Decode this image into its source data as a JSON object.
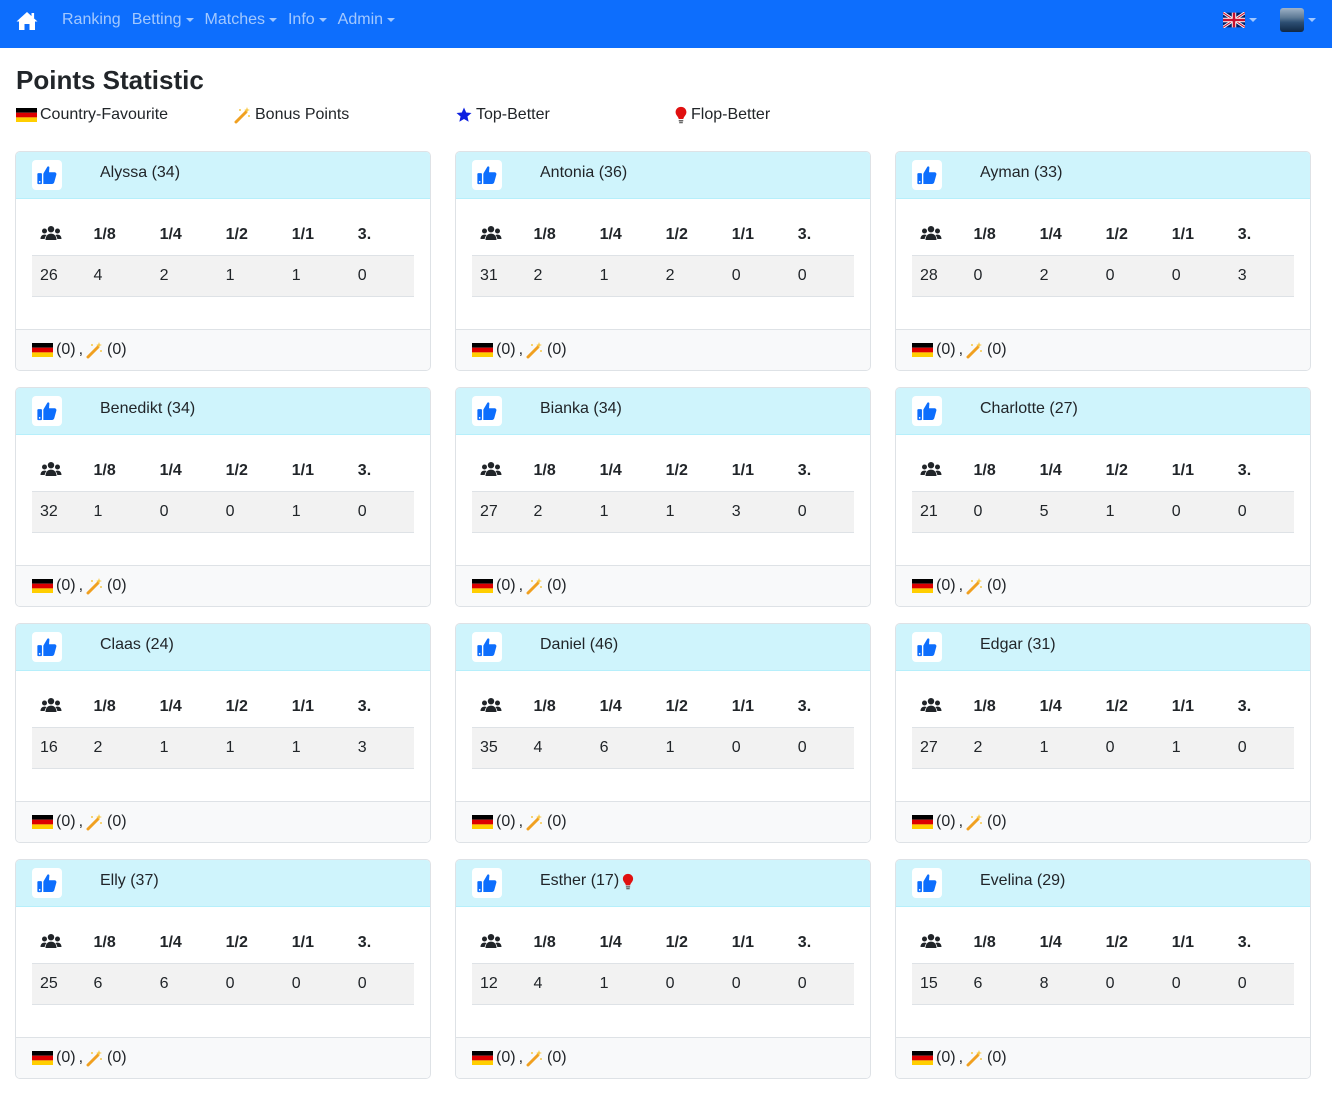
{
  "nav": {
    "items": [
      {
        "label": "Ranking",
        "dropdown": false
      },
      {
        "label": "Betting",
        "dropdown": true
      },
      {
        "label": "Matches",
        "dropdown": true
      },
      {
        "label": "Info",
        "dropdown": true
      },
      {
        "label": "Admin",
        "dropdown": true
      }
    ],
    "home_icon": "home-icon",
    "language_icon": "uk-flag-icon",
    "brand_color": "#0d6efd"
  },
  "page": {
    "title": "Points Statistic",
    "legend": [
      {
        "icon": "germany-flag-icon",
        "label": "Country-Favourite"
      },
      {
        "icon": "magic-wand-icon",
        "label": "Bonus Points"
      },
      {
        "icon": "star-icon",
        "label": "Top-Better"
      },
      {
        "icon": "lightbulb-icon",
        "label": "Flop-Better"
      }
    ]
  },
  "columns": [
    "1/8",
    "1/4",
    "1/2",
    "1/1",
    "3."
  ],
  "cards": [
    {
      "name": "Alyssa (34)",
      "flop": false,
      "values": [
        "26",
        "4",
        "2",
        "1",
        "1",
        "0"
      ],
      "country": "(0)",
      "bonus": "(0)"
    },
    {
      "name": "Antonia (36)",
      "flop": false,
      "values": [
        "31",
        "2",
        "1",
        "2",
        "0",
        "0"
      ],
      "country": "(0)",
      "bonus": "(0)"
    },
    {
      "name": "Ayman (33)",
      "flop": false,
      "values": [
        "28",
        "0",
        "2",
        "0",
        "0",
        "3"
      ],
      "country": "(0)",
      "bonus": "(0)"
    },
    {
      "name": "Benedikt (34)",
      "flop": false,
      "values": [
        "32",
        "1",
        "0",
        "0",
        "1",
        "0"
      ],
      "country": "(0)",
      "bonus": "(0)"
    },
    {
      "name": "Bianka (34)",
      "flop": false,
      "values": [
        "27",
        "2",
        "1",
        "1",
        "3",
        "0"
      ],
      "country": "(0)",
      "bonus": "(0)"
    },
    {
      "name": "Charlotte (27)",
      "flop": false,
      "values": [
        "21",
        "0",
        "5",
        "1",
        "0",
        "0"
      ],
      "country": "(0)",
      "bonus": "(0)"
    },
    {
      "name": "Claas (24)",
      "flop": false,
      "values": [
        "16",
        "2",
        "1",
        "1",
        "1",
        "3"
      ],
      "country": "(0)",
      "bonus": "(0)"
    },
    {
      "name": "Daniel (46)",
      "flop": false,
      "values": [
        "35",
        "4",
        "6",
        "1",
        "0",
        "0"
      ],
      "country": "(0)",
      "bonus": "(0)"
    },
    {
      "name": "Edgar (31)",
      "flop": false,
      "values": [
        "27",
        "2",
        "1",
        "0",
        "1",
        "0"
      ],
      "country": "(0)",
      "bonus": "(0)"
    },
    {
      "name": "Elly (37)",
      "flop": false,
      "values": [
        "25",
        "6",
        "6",
        "0",
        "0",
        "0"
      ],
      "country": "(0)",
      "bonus": "(0)"
    },
    {
      "name": "Esther (17)",
      "flop": true,
      "values": [
        "12",
        "4",
        "1",
        "0",
        "0",
        "0"
      ],
      "country": "(0)",
      "bonus": "(0)"
    },
    {
      "name": "Evelina (29)",
      "flop": false,
      "values": [
        "15",
        "6",
        "8",
        "0",
        "0",
        "0"
      ],
      "country": "(0)",
      "bonus": "(0)"
    }
  ]
}
